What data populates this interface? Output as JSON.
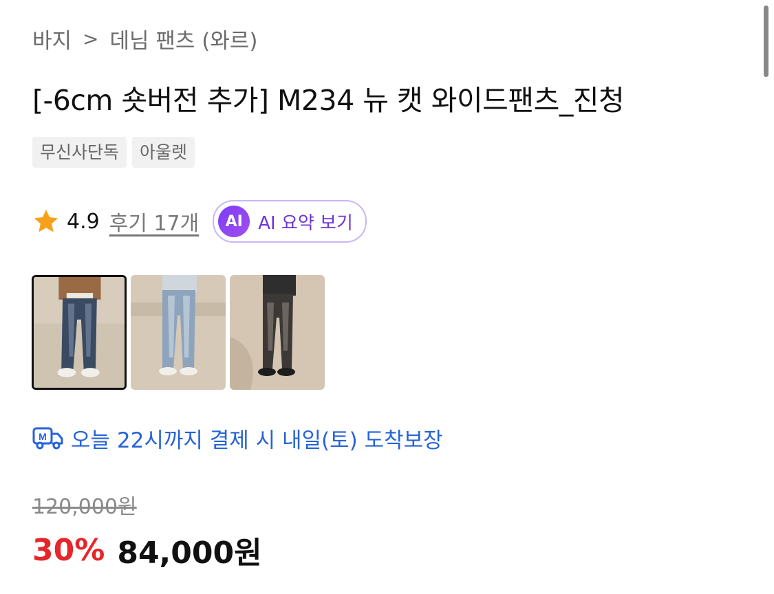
{
  "breadcrumb": {
    "level1": "바지",
    "separator": ">",
    "level2": "데님 팬츠 (와르)"
  },
  "product": {
    "title": "[-6cm 숏버전 추가] M234 뉴 캣 와이드팬츠_진청"
  },
  "tags": [
    "무신사단독",
    "아울렛"
  ],
  "rating": {
    "score": "4.9",
    "reviews": "후기 17개"
  },
  "ai_summary": {
    "badge": "AI",
    "label": "AI 요약 보기"
  },
  "thumbnails": [
    {
      "name": "thumbnail-1",
      "selected": true
    },
    {
      "name": "thumbnail-2",
      "selected": false
    },
    {
      "name": "thumbnail-3",
      "selected": false
    }
  ],
  "delivery": {
    "icon": "delivery-truck-icon",
    "text": "오늘 22시까지 결제 시 내일(토) 도착보장"
  },
  "price": {
    "original": "120,000원",
    "discount": "30%",
    "final": "84,000원"
  },
  "colors": {
    "accent_blue": "#2663d8",
    "discount_red": "#e6262a",
    "ai_purple": "#7d3cf6",
    "star": "#f7a11a"
  }
}
